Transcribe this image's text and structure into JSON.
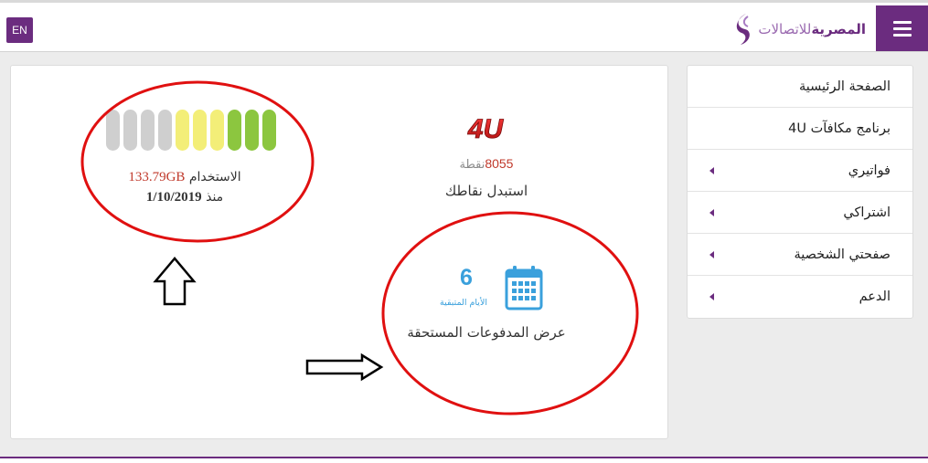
{
  "header": {
    "brand_bold": "المصرية",
    "brand_light": "للاتصالات",
    "lang_button": "EN",
    "accent_color": "#6b2c7f",
    "menu_icon": "hamburger-icon",
    "logo_icon": "we-swirl-logo"
  },
  "sidebar": {
    "items": [
      {
        "label": "الصفحة الرئيسية",
        "has_submenu": false
      },
      {
        "label": "برنامج مكافآت 4U",
        "has_submenu": false
      },
      {
        "label": "فواتيري",
        "has_submenu": true
      },
      {
        "label": "اشتراكي",
        "has_submenu": true
      },
      {
        "label": "صفحتي الشخصية",
        "has_submenu": true
      },
      {
        "label": "الدعم",
        "has_submenu": true
      }
    ]
  },
  "usage": {
    "label": "الاستخدام",
    "value": "133.79GB",
    "since_label": "منذ",
    "since_date": "1/10/2019",
    "meter_colors": [
      "#cfcfcf",
      "#cfcfcf",
      "#cfcfcf",
      "#cfcfcf",
      "#f3ee78",
      "#f3ee78",
      "#f3ee78",
      "#8cc63f",
      "#8cc63f",
      "#8cc63f"
    ]
  },
  "rewards": {
    "logo_text": "4U",
    "points": "8055",
    "points_unit": "نقطة",
    "redeem_label": "استبدل نقاطك"
  },
  "dues": {
    "days": "6",
    "days_label": "الأيام المتبقية",
    "label": "عرض المدفوعات المستحقة",
    "icon": "calendar-icon"
  },
  "annotations": {
    "ellipse_color": "#e01010",
    "arrow_up": "arrow-up-outline",
    "arrow_right": "arrow-right-outline"
  }
}
